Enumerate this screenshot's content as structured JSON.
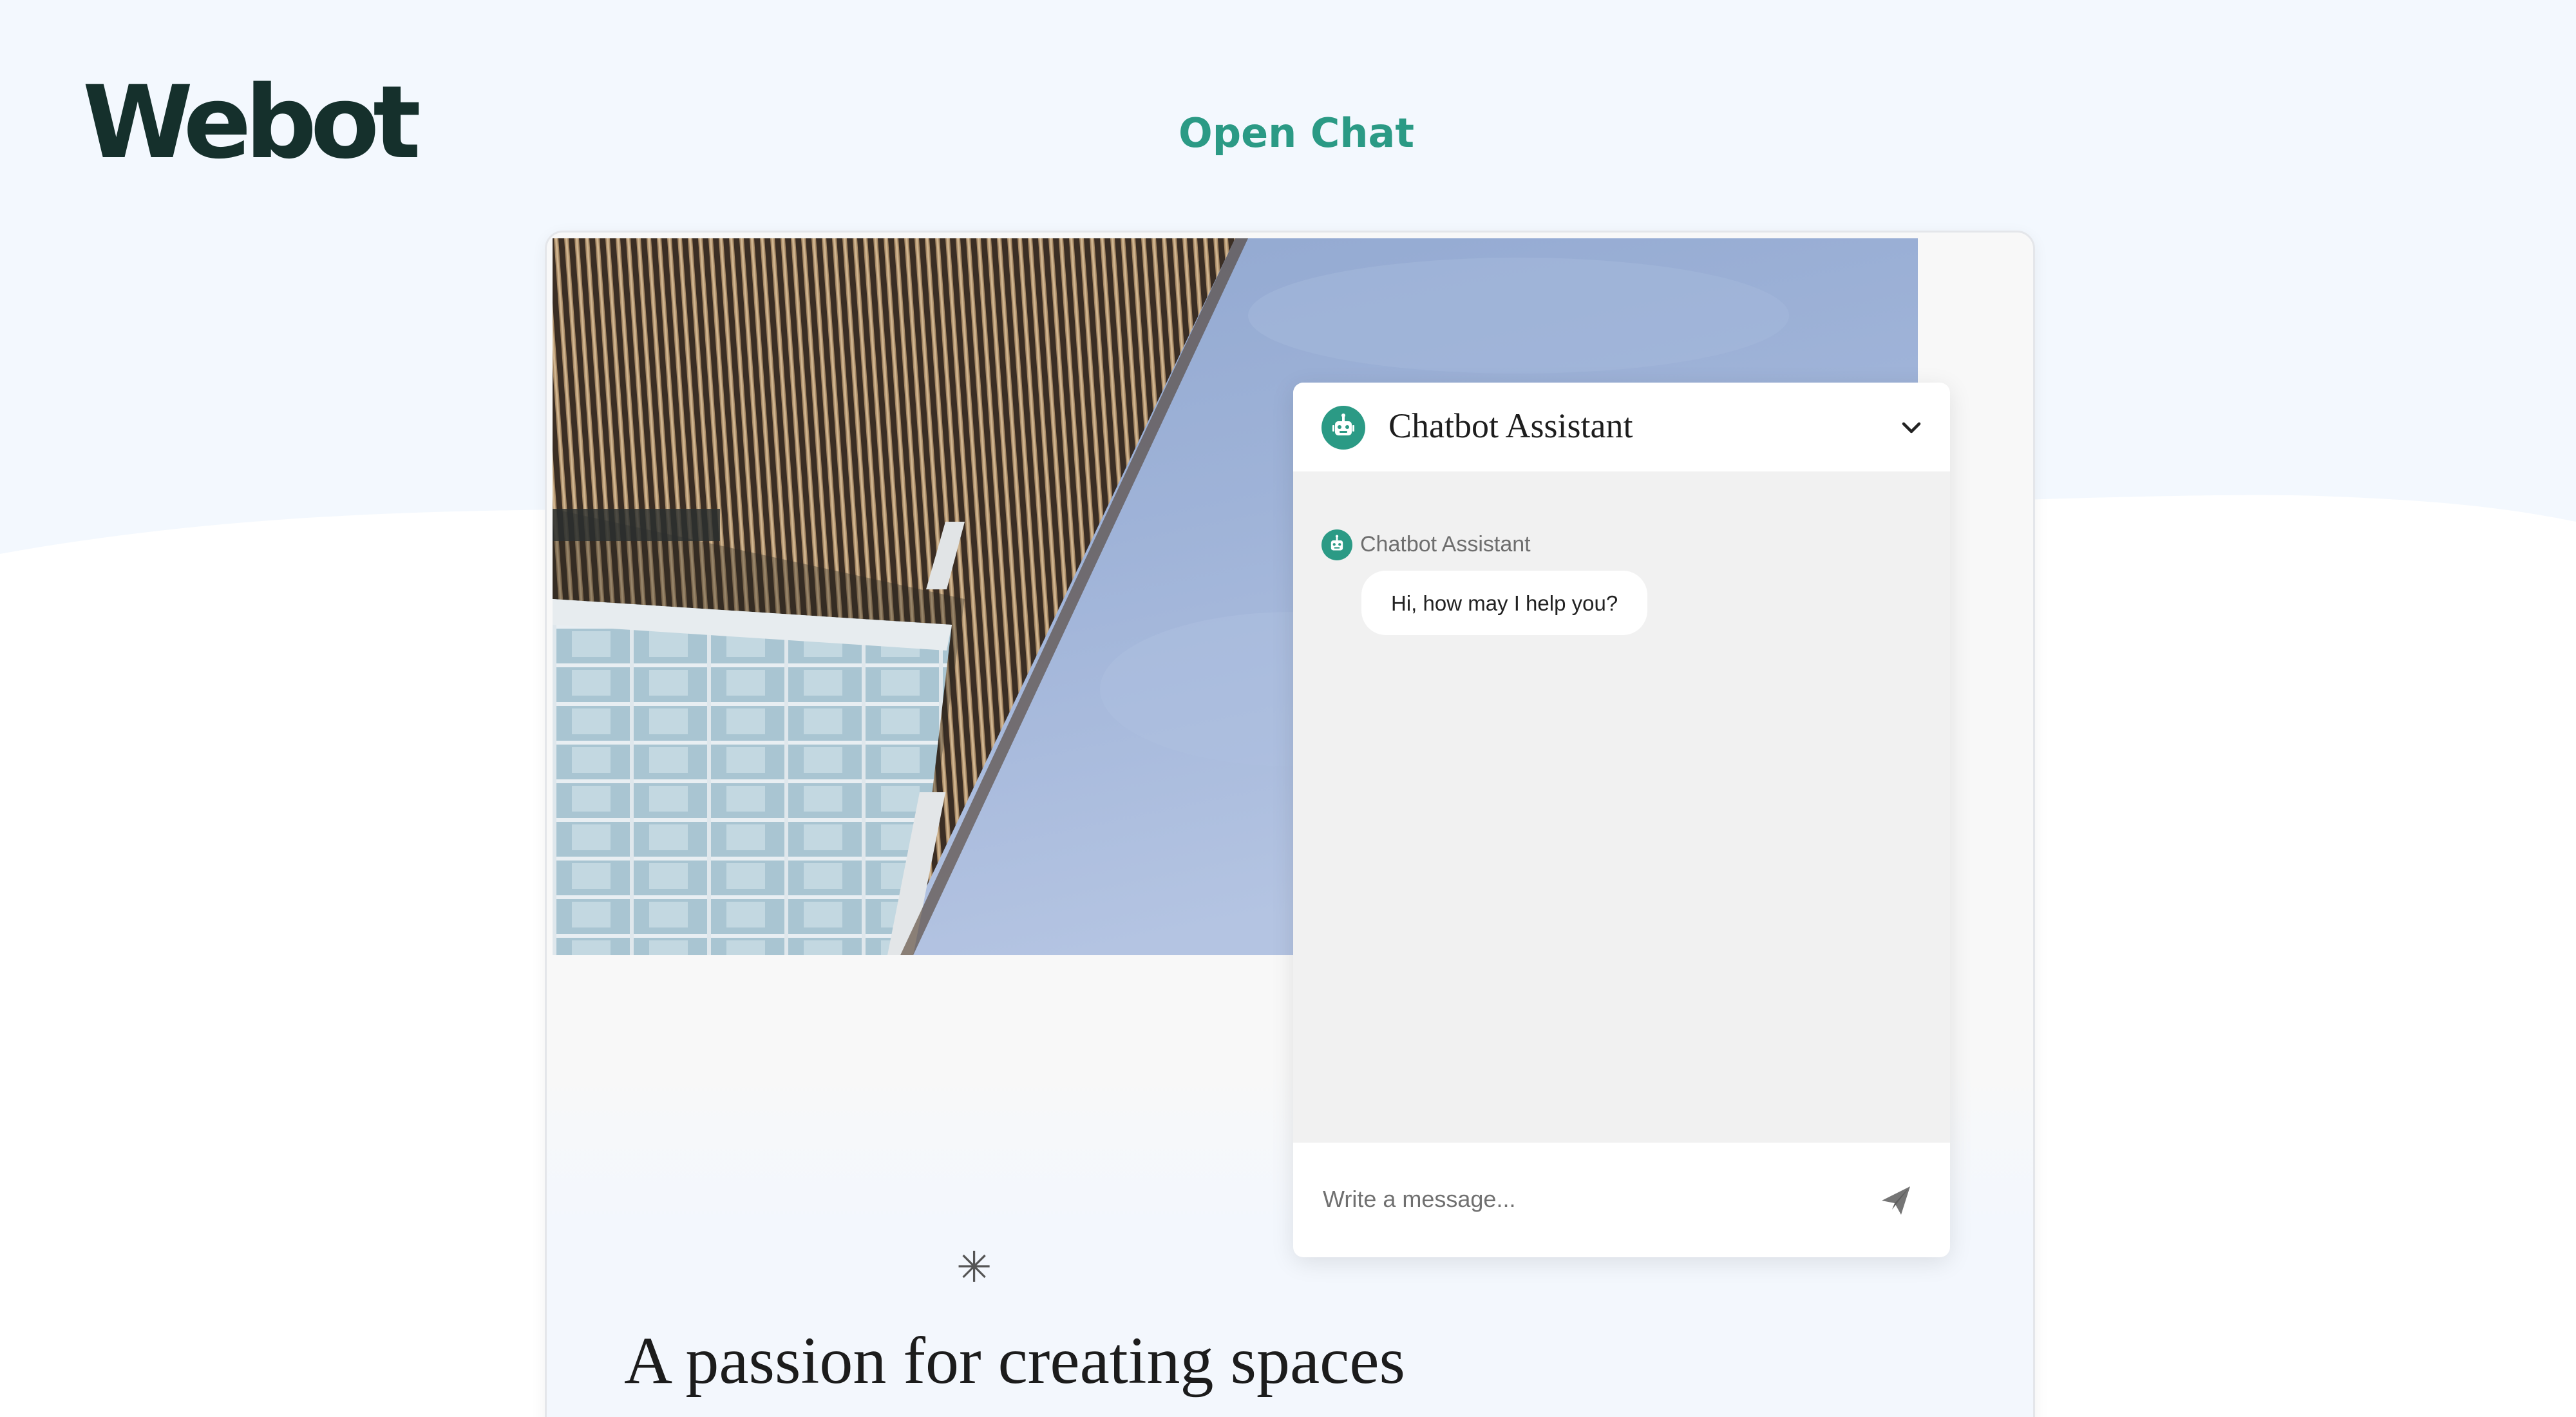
{
  "brand": {
    "logo_text": "Webot"
  },
  "header": {
    "open_chat_label": "Open Chat"
  },
  "page": {
    "headline": "A passion for creating spaces",
    "asterisk": "✳"
  },
  "chat": {
    "title": "Chatbot Assistant",
    "messages": [
      {
        "sender": "Chatbot Assistant",
        "text": "Hi, how may I help you?"
      }
    ],
    "input": {
      "placeholder": "Write a message...",
      "value": ""
    }
  },
  "icons": {
    "bot": "robot-icon",
    "collapse": "chevron-down-icon",
    "send": "paper-plane-icon"
  },
  "colors": {
    "accent": "#2b9a85",
    "background": "#f3f8fe",
    "logo": "#15302c"
  }
}
